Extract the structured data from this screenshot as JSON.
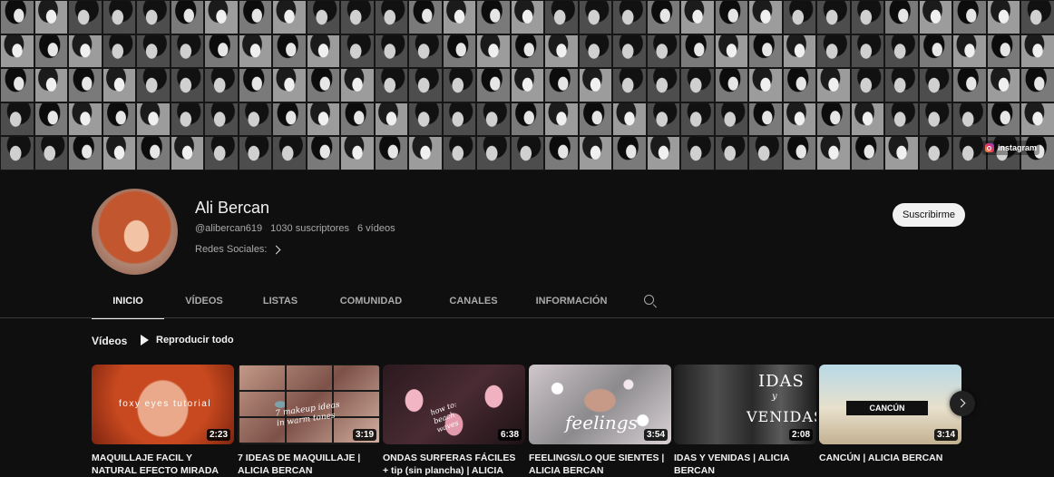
{
  "banner": {
    "link_label": "instagram",
    "link_icon": "instagram-icon"
  },
  "channel": {
    "name": "Ali Bercan",
    "handle": "@alibercan619",
    "subscribers": "1030 suscriptores",
    "videos_count": "6 vídeos",
    "links_label": "Redes Sociales:",
    "subscribe_label": "Suscribirme"
  },
  "tabs": [
    {
      "label": "INICIO",
      "active": true
    },
    {
      "label": "VÍDEOS",
      "active": false
    },
    {
      "label": "LISTAS",
      "active": false
    },
    {
      "label": "COMUNIDAD",
      "active": false
    },
    {
      "label": "CANALES",
      "active": false
    },
    {
      "label": "INFORMACIÓN",
      "active": false
    }
  ],
  "section": {
    "title": "Vídeos",
    "play_all_label": "Reproducir todo"
  },
  "videos": [
    {
      "title": "MAQUILLAJE FACIL Y NATURAL EFECTO MIRADA",
      "duration": "2:23",
      "thumb_text": "foxy eyes tutorial"
    },
    {
      "title": "7 IDEAS DE MAQUILLAJE | ALICIA BERCAN",
      "duration": "3:19",
      "thumb_text": "7 makeup ideas in warm tones"
    },
    {
      "title": "ONDAS SURFERAS FÁCILES + tip (sin plancha) | ALICIA",
      "duration": "6:38",
      "thumb_text": "how to: beach waves"
    },
    {
      "title": "FEELINGS/LO QUE SIENTES | ALICIA BERCAN",
      "duration": "3:54",
      "thumb_text": "feelings"
    },
    {
      "title": "IDAS Y VENIDAS | ALICIA BERCAN",
      "duration": "2:08",
      "thumb_text_1": "IDAS",
      "thumb_text_2": "y",
      "thumb_text_3": "VENIDAS"
    },
    {
      "title": "CANCÚN | ALICIA BERCAN",
      "duration": "3:14",
      "thumb_text": "CANCÚN"
    }
  ]
}
